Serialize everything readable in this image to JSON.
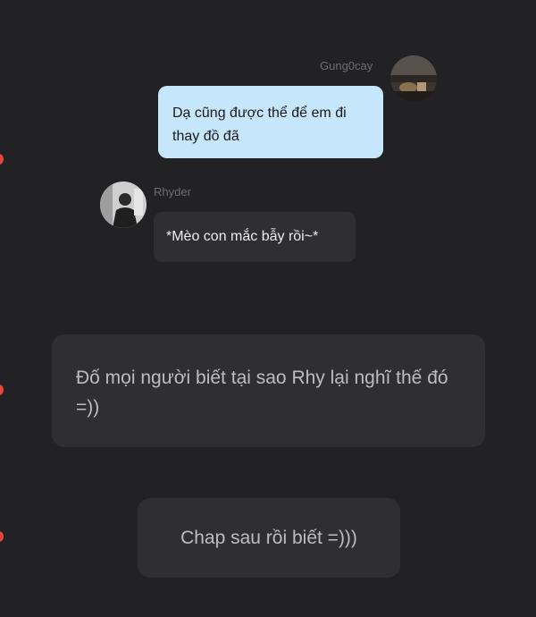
{
  "messages": [
    {
      "sender": "Gung0cay",
      "side": "right",
      "avatar_icon": "profile-photo-landscape",
      "text": "Dạ cũng được thể để em đi thay đồ đã",
      "bubble_color": "#c6e6fb"
    },
    {
      "sender": "Rhyder",
      "side": "left",
      "avatar_icon": "profile-photo-person",
      "text": "*Mèo con mắc bẫy rồi~*",
      "bubble_color": "#2f2f32"
    }
  ],
  "narration": [
    {
      "text": "Đố mọi người biết tại sao Rhy lại nghĩ thế đó =))"
    },
    {
      "text": "Chap sau rồi biết =)))"
    }
  ],
  "colors": {
    "background": "#222224",
    "accent_dot": "#e8453c",
    "name_text": "#6d6d72"
  }
}
